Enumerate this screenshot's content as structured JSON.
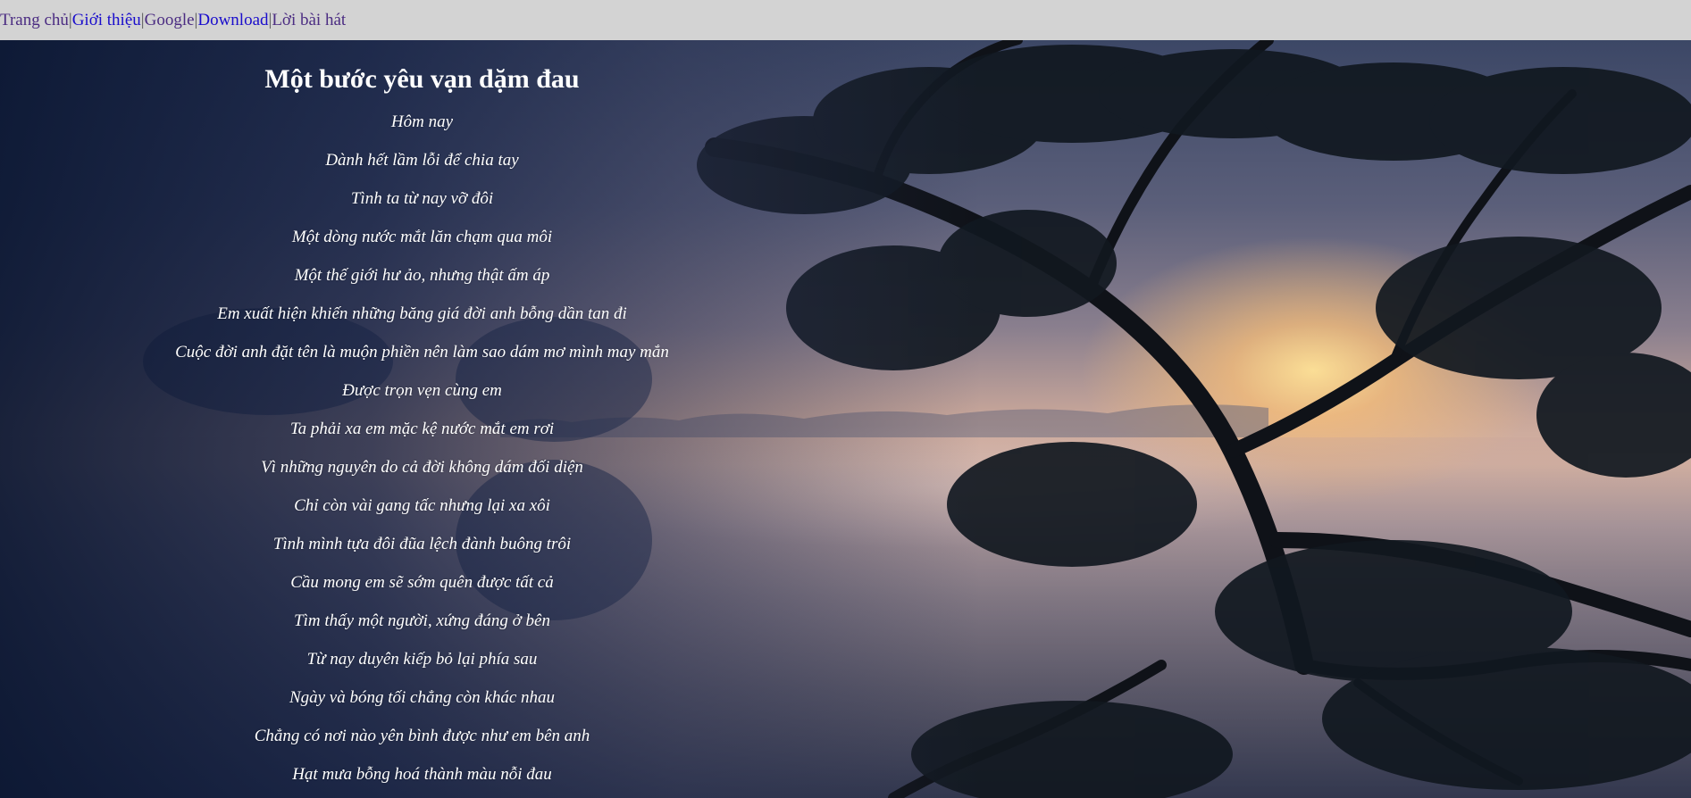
{
  "nav": {
    "items": [
      {
        "label": "Trang chủ"
      },
      {
        "label": "Giới thiệu"
      },
      {
        "label": "Google"
      },
      {
        "label": "Download"
      },
      {
        "label": "Lời bài hát"
      }
    ],
    "separator": "|"
  },
  "song": {
    "title": "Một bước yêu vạn dặm đau",
    "lines": [
      "Hôm nay",
      "Dành hết lầm lỗi để chia tay",
      "Tình ta từ nay vỡ đôi",
      "Một dòng nước mắt lăn chạm qua môi",
      "Một thế giới hư ảo, nhưng thật ấm áp",
      "Em xuất hiện khiến những băng giá đời anh bỗng dần tan đi",
      "Cuộc đời anh đặt tên là muộn phiền nên làm sao dám mơ mình may mắn",
      "Được trọn vẹn cùng em",
      "Ta phải xa em mặc kệ nước mắt em rơi",
      "Vì những nguyên do cả đời không dám đối diện",
      "Chỉ còn vài gang tấc nhưng lại xa xôi",
      "Tình mình tựa đôi đũa lệch đành buông trôi",
      "Cầu mong em sẽ sớm quên được tất cả",
      "Tìm thấy một người, xứng đáng ở bên",
      "Từ nay duyên kiếp bỏ lại phía sau",
      "Ngày và bóng tối chẳng còn khác nhau",
      "Chẳng có nơi nào yên bình được như em bên anh",
      "Hạt mưa bỗng hoá thành màu nỗi đau"
    ]
  }
}
